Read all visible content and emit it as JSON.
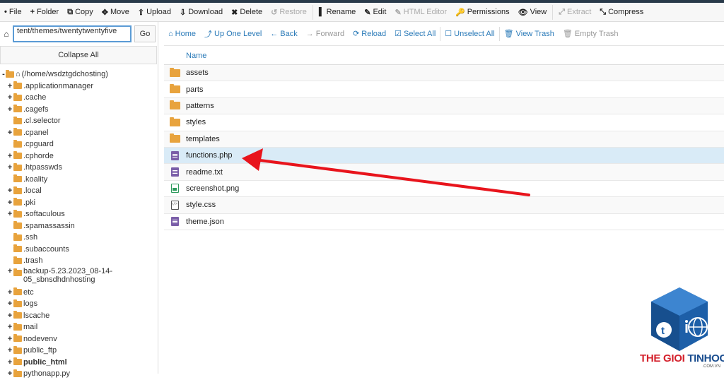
{
  "toolbar": {
    "items": [
      {
        "icon": "•",
        "label": "File",
        "disabled": false
      },
      {
        "icon": "+",
        "label": "Folder",
        "disabled": false
      },
      {
        "icon": "⧉",
        "label": "Copy",
        "disabled": false
      },
      {
        "icon": "✥",
        "label": "Move",
        "disabled": false
      },
      {
        "icon": "⇧",
        "label": "Upload",
        "disabled": false
      },
      {
        "icon": "⇩",
        "label": "Download",
        "disabled": false
      },
      {
        "icon": "✖",
        "label": "Delete",
        "disabled": false
      },
      {
        "icon": "↺",
        "label": "Restore",
        "disabled": true
      },
      {
        "icon": "▌",
        "label": "Rename",
        "disabled": false
      },
      {
        "icon": "✎",
        "label": "Edit",
        "disabled": false
      },
      {
        "icon": "✎",
        "label": "HTML Editor",
        "disabled": true
      },
      {
        "icon": "🔑",
        "label": "Permissions",
        "disabled": false
      },
      {
        "icon": "👁",
        "label": "View",
        "disabled": false
      },
      {
        "icon": "⤢",
        "label": "Extract",
        "disabled": true
      },
      {
        "icon": "⤡",
        "label": "Compress",
        "disabled": false
      }
    ]
  },
  "sidebar": {
    "path_value": "tent/themes/twentytwentyfive",
    "go_label": "Go",
    "collapse_label": "Collapse All",
    "root_label": "(/home/wsdztgdchosting)",
    "tree": [
      {
        "label": ".applicationmanager",
        "exp": "+"
      },
      {
        "label": ".cache",
        "exp": "+"
      },
      {
        "label": ".cagefs",
        "exp": "+"
      },
      {
        "label": ".cl.selector",
        "exp": ""
      },
      {
        "label": ".cpanel",
        "exp": "+"
      },
      {
        "label": ".cpguard",
        "exp": ""
      },
      {
        "label": ".cphorde",
        "exp": "+"
      },
      {
        "label": ".htpasswds",
        "exp": "+"
      },
      {
        "label": ".koality",
        "exp": ""
      },
      {
        "label": ".local",
        "exp": "+"
      },
      {
        "label": ".pki",
        "exp": "+"
      },
      {
        "label": ".softaculous",
        "exp": "+"
      },
      {
        "label": ".spamassassin",
        "exp": ""
      },
      {
        "label": ".ssh",
        "exp": ""
      },
      {
        "label": ".subaccounts",
        "exp": ""
      },
      {
        "label": ".trash",
        "exp": ""
      },
      {
        "label": "backup-5.23.2023_08-14-05_sbnsdhdnhosting",
        "exp": "+",
        "multi": true
      },
      {
        "label": "etc",
        "exp": "+"
      },
      {
        "label": "logs",
        "exp": "+"
      },
      {
        "label": "lscache",
        "exp": "+"
      },
      {
        "label": "mail",
        "exp": "+"
      },
      {
        "label": "nodevenv",
        "exp": "+"
      },
      {
        "label": "public_ftp",
        "exp": "+"
      },
      {
        "label": "public_html",
        "exp": "+",
        "bold": true
      },
      {
        "label": "pythonapp.py",
        "exp": "+"
      }
    ]
  },
  "navbar": {
    "items": [
      {
        "icon": "⌂",
        "label": "Home",
        "disabled": false
      },
      {
        "icon": "⤴",
        "label": "Up One Level",
        "disabled": false
      },
      {
        "icon": "←",
        "label": "Back",
        "disabled": false
      },
      {
        "icon": "→",
        "label": "Forward",
        "disabled": true
      },
      {
        "icon": "⟳",
        "label": "Reload",
        "disabled": false
      },
      {
        "icon": "☑",
        "label": "Select All",
        "disabled": false
      },
      {
        "icon": "☐",
        "label": "Unselect All",
        "disabled": false
      },
      {
        "icon": "🗑",
        "label": "View Trash",
        "disabled": false
      },
      {
        "icon": "🗑",
        "label": "Empty Trash",
        "disabled": true
      }
    ]
  },
  "files": {
    "column_name": "Name",
    "rows": [
      {
        "name": "assets",
        "type": "folder"
      },
      {
        "name": "parts",
        "type": "folder"
      },
      {
        "name": "patterns",
        "type": "folder"
      },
      {
        "name": "styles",
        "type": "folder"
      },
      {
        "name": "templates",
        "type": "folder"
      },
      {
        "name": "functions.php",
        "type": "php",
        "selected": true
      },
      {
        "name": "readme.txt",
        "type": "txt"
      },
      {
        "name": "screenshot.png",
        "type": "png"
      },
      {
        "name": "style.css",
        "type": "css"
      },
      {
        "name": "theme.json",
        "type": "json"
      }
    ]
  },
  "watermark": {
    "part1": "THE GIOI ",
    "part2": "TINHOC",
    "sub": ".COM.VN"
  },
  "colors": {
    "accent": "#2a7ab8",
    "folder": "#e8a33d",
    "selected_row": "#d9ebf7",
    "arrow": "#e8141c"
  }
}
